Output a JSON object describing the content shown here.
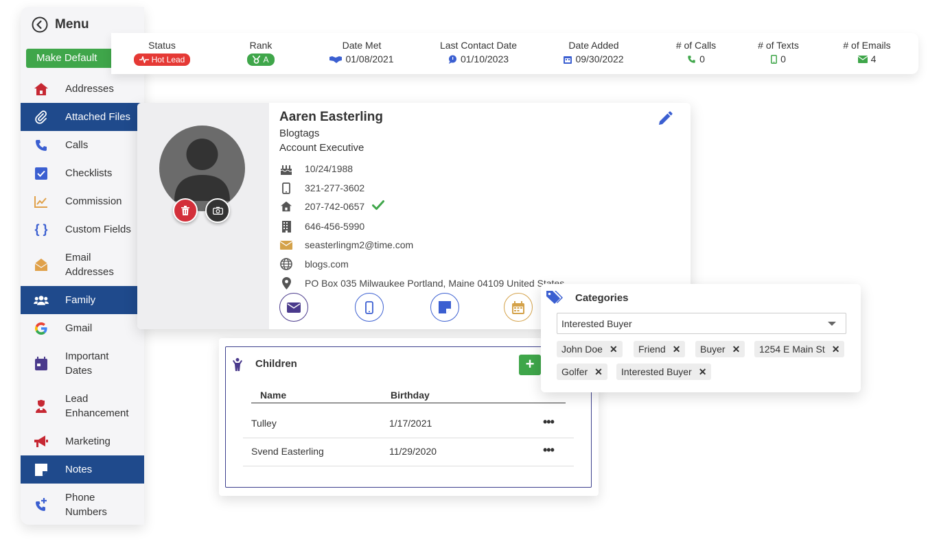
{
  "menu": {
    "title": "Menu",
    "make_default": "Make Default",
    "items": [
      {
        "label": "Addresses"
      },
      {
        "label": "Attached Files"
      },
      {
        "label": "Calls"
      },
      {
        "label": "Checklists"
      },
      {
        "label": "Commission"
      },
      {
        "label": "Custom Fields"
      },
      {
        "label": "Email\nAddresses"
      },
      {
        "label": "Family"
      },
      {
        "label": "Gmail"
      },
      {
        "label": "Important\nDates"
      },
      {
        "label": "Lead\nEnhancement"
      },
      {
        "label": "Marketing"
      },
      {
        "label": "Notes"
      },
      {
        "label": "Phone\nNumbers"
      }
    ]
  },
  "stats": {
    "status": {
      "label": "Status",
      "value": "Hot Lead",
      "color": "#e53935"
    },
    "rank": {
      "label": "Rank",
      "value": "A",
      "color": "#3fa64a"
    },
    "date_met": {
      "label": "Date Met",
      "value": "01/08/2021"
    },
    "last_contact": {
      "label": "Last Contact Date",
      "value": "01/10/2023"
    },
    "date_added": {
      "label": "Date Added",
      "value": "09/30/2022"
    },
    "calls": {
      "label": "# of Calls",
      "value": "0"
    },
    "texts": {
      "label": "# of Texts",
      "value": "0"
    },
    "emails": {
      "label": "# of Emails",
      "value": "4"
    }
  },
  "contact": {
    "name": "Aaren Easterling",
    "company": "Blogtags",
    "title": "Account Executive",
    "birthday": "10/24/1988",
    "mobile": "321-277-3602",
    "home": "207-742-0657",
    "work": "646-456-5990",
    "email": "seasterlingm2@time.com",
    "website": "blogs.com",
    "address": "PO Box 035 Milwaukee Portland, Maine 04109 United States"
  },
  "children": {
    "title": "Children",
    "add_label": "+",
    "columns": [
      "Name",
      "Birthday"
    ],
    "rows": [
      {
        "name": "Tulley",
        "birthday": "1/17/2021",
        "menu": "•••"
      },
      {
        "name": "Svend Easterling",
        "birthday": "11/29/2020",
        "menu": "•••"
      }
    ]
  },
  "categories": {
    "title": "Categories",
    "selected": "Interested Buyer",
    "tags": [
      "John Doe",
      "Friend",
      "Buyer",
      "1254 E Main St",
      "Golfer",
      "Interested Buyer"
    ],
    "remove_glyph": "✕"
  },
  "colors": {
    "navy": "#1f4a8c",
    "green": "#3fa64a",
    "red": "#d32f3a",
    "accent_blue": "#3b5fd1",
    "purple": "#3b3e8c",
    "gold": "#d4a24a"
  }
}
